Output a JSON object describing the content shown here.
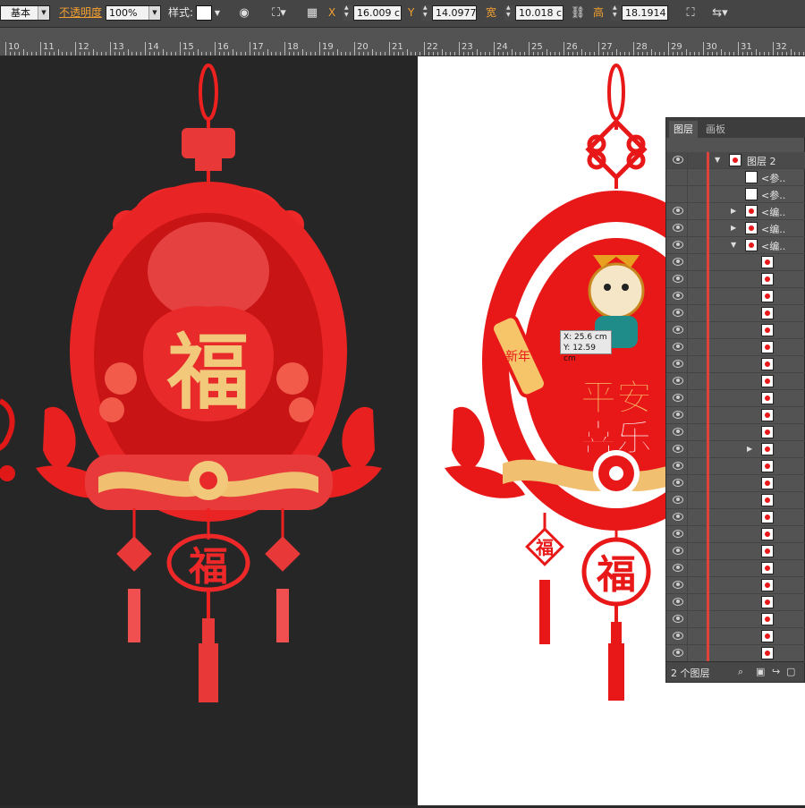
{
  "control_bar": {
    "brush_preset": "基本",
    "opacity_label": "不透明度",
    "opacity_value": "100%",
    "style_label": "样式",
    "x_label": "X",
    "x_value": "16.009 cr",
    "y_label": "Y",
    "y_value": "14.0977",
    "width_label": "宽",
    "width_value": "10.018 cr",
    "height_label": "高",
    "height_value": "18.1914"
  },
  "ruler": {
    "labels": [
      "10",
      "11",
      "12",
      "13",
      "14",
      "15",
      "16",
      "17",
      "18",
      "19",
      "20",
      "21",
      "22",
      "23",
      "24",
      "25",
      "26",
      "27",
      "28",
      "29",
      "30",
      "31",
      "32"
    ]
  },
  "artwork": {
    "dark_fu": "福",
    "dark_medallion": "福",
    "white_phrase_1": "平安",
    "white_phrase_2": "喜乐",
    "white_small_fu": "福",
    "white_medallion": "福",
    "scroll_text": "新年"
  },
  "cursor_tooltip": {
    "x": "X: 25.6 cm",
    "y": "Y: 12.59 cm"
  },
  "layers_panel": {
    "tabs": [
      "图层",
      "画板"
    ],
    "top_layer_name": "图层 2",
    "named_rows": [
      "<参..",
      "<参..",
      "<编..",
      "<编..",
      "<编.."
    ],
    "footer_count": "2 个图层"
  },
  "colors": {
    "accent_orange": "#f4a030",
    "paper_red": "#e81818",
    "gold": "#f0c878"
  }
}
